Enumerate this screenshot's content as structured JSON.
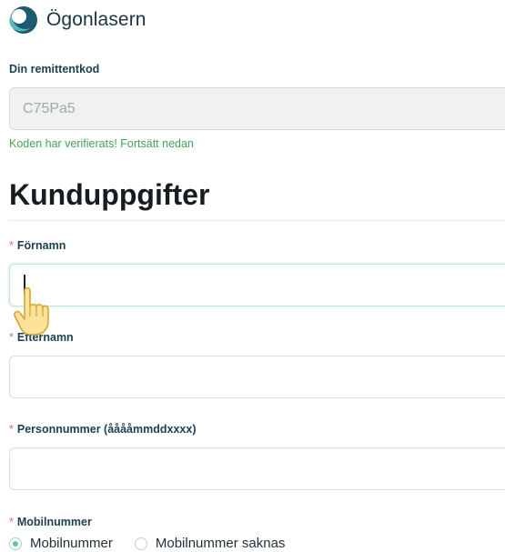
{
  "brand": {
    "name": "Ögonlasern"
  },
  "referral": {
    "label": "Din remittentkod",
    "value": "C75Pa5",
    "success_message": "Koden har verifierats! Fortsätt nedan"
  },
  "section": {
    "title": "Kunduppgifter"
  },
  "form": {
    "required_marker": "*",
    "first_name": {
      "label": "Förnamn",
      "value": ""
    },
    "last_name": {
      "label": "Efternamn",
      "value": ""
    },
    "personal_number": {
      "label": "Personnummer (ååååmmddxxxx)",
      "value": ""
    },
    "mobile": {
      "label": "Mobilnummer",
      "options": [
        {
          "label": "Mobilnummer",
          "selected": true
        },
        {
          "label": "Mobilnummer saknas",
          "selected": false
        }
      ]
    }
  },
  "colors": {
    "accent": "#5dc5b0",
    "label": "#1d4150",
    "success": "#3fa654",
    "required": "#e06a6a",
    "logo_dark": "#1f5a73"
  },
  "icons": {
    "logo": "eye-logo-icon",
    "cursor": "hand-pointer-icon"
  }
}
